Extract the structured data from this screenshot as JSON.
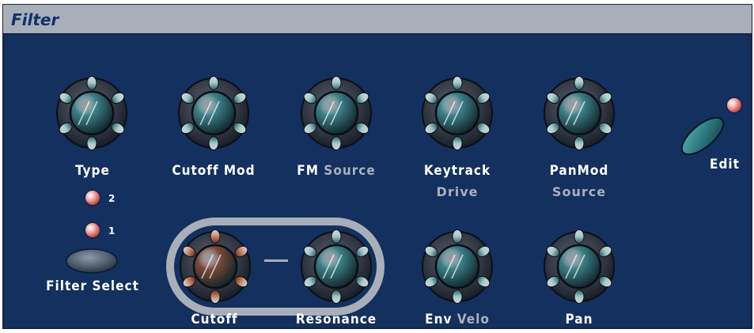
{
  "panel": {
    "title": "Filter"
  },
  "knobs": [
    {
      "id": "type",
      "label": "Type",
      "label_dim": "",
      "sublabel": ""
    },
    {
      "id": "cutoff-mod",
      "label": "Cutoff Mod",
      "label_dim": "",
      "sublabel": ""
    },
    {
      "id": "fm",
      "label": "FM",
      "label_dim": "Source",
      "sublabel": ""
    },
    {
      "id": "keytrack",
      "label": "Keytrack",
      "label_dim": "",
      "sublabel": "Drive"
    },
    {
      "id": "panmod",
      "label": "PanMod",
      "label_dim": "",
      "sublabel": "Source"
    },
    {
      "id": "cutoff",
      "label": "Cutoff",
      "label_dim": "",
      "sublabel": ""
    },
    {
      "id": "resonance",
      "label": "Resonance",
      "label_dim": "",
      "sublabel": ""
    },
    {
      "id": "env",
      "label": "Env",
      "label_dim": "Velo",
      "sublabel": ""
    },
    {
      "id": "pan",
      "label": "Pan",
      "label_dim": "",
      "sublabel": ""
    }
  ],
  "filter_select": {
    "label": "Filter Select",
    "led_2": "2",
    "led_1": "1"
  },
  "edit": {
    "label": "Edit"
  },
  "colors": {
    "panel_bg": "#13305e",
    "header_bg": "#a9afb8",
    "label": "#ffffff",
    "label_dim": "#a9b0bd",
    "knob_teal": "#3d7f88",
    "knob_cutoff": "#7a4a3a",
    "led": "#d86060"
  }
}
